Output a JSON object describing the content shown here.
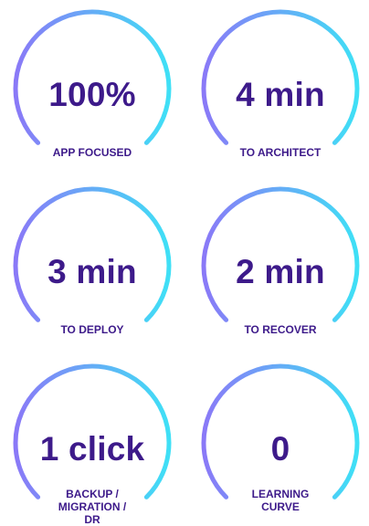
{
  "colors": {
    "arc_start": "#8a79f7",
    "arc_end": "#3fe0f6",
    "text": "#3d1a8a",
    "background": "#ffffff"
  },
  "stats": [
    {
      "value": "100%",
      "label": "APP FOCUSED"
    },
    {
      "value": "4 min",
      "label": "TO ARCHITECT"
    },
    {
      "value": "3 min",
      "label": "TO DEPLOY"
    },
    {
      "value": "2 min",
      "label": "TO RECOVER"
    },
    {
      "value": "1 click",
      "label": "BACKUP / MIGRATION / DR"
    },
    {
      "value": "0",
      "label": "LEARNING CURVE"
    }
  ]
}
